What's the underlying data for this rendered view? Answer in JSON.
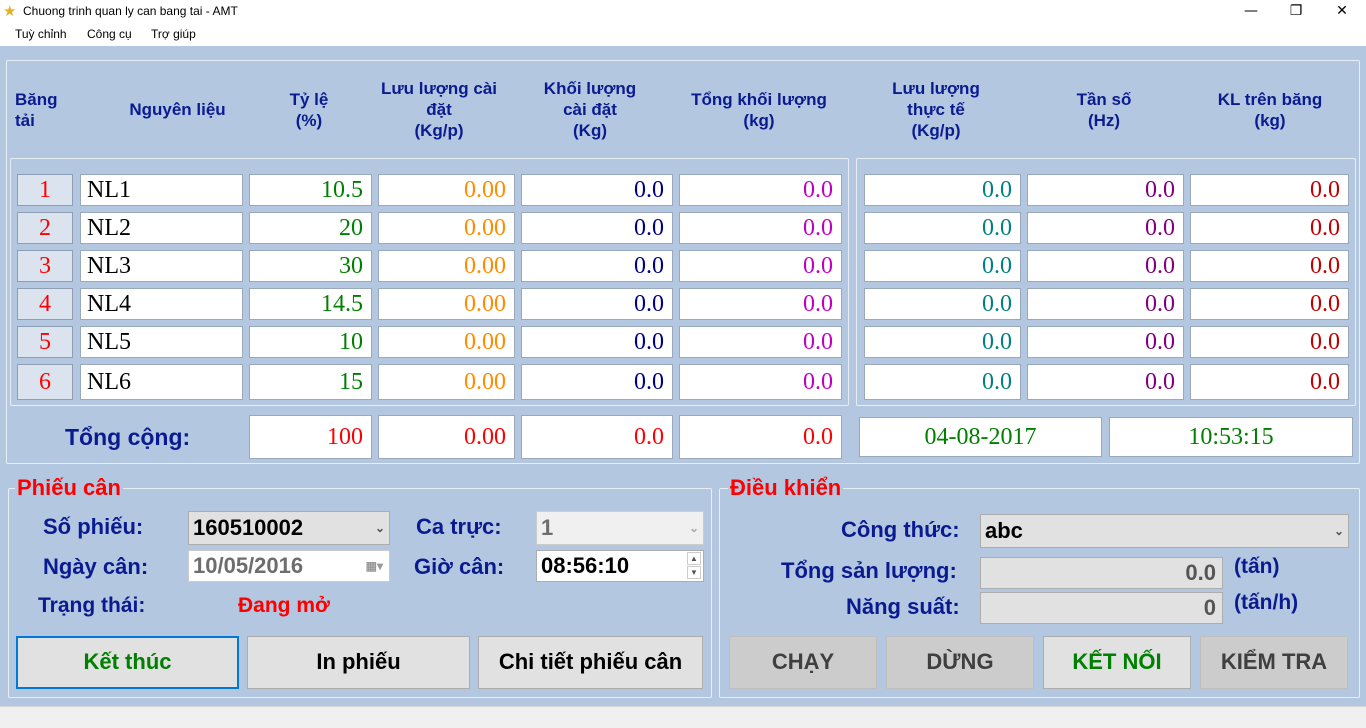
{
  "window": {
    "title": "Chuong trinh quan ly can bang tai - AMT",
    "minimize": "—",
    "restore": "❐",
    "close": "✕"
  },
  "menu": [
    "Tuỳ chỉnh",
    "Công cụ",
    "Trợ giúp"
  ],
  "headers": {
    "bang_tai": "Băng\ntải",
    "nguyen_lieu": "Nguyên liệu",
    "ty_le": "Tỷ lệ\n(%)",
    "luu_luong_cai_dat": "Lưu lượng cài\nđặt\n(Kg/p)",
    "khoi_luong_cai_dat": "Khối lượng\ncài đặt\n(Kg)",
    "tong_khoi_luong": "Tổng khối lượng\n(kg)",
    "luu_luong_thuc_te": "Lưu lượng\nthực tế\n(Kg/p)",
    "tan_so": "Tần số\n(Hz)",
    "kl_tren_bang": "KL trên băng\n(kg)"
  },
  "rows": [
    {
      "idx": "1",
      "name": "NL1",
      "ratio": "10.5",
      "flow_set": "0.00",
      "mass_set": "0.0",
      "total_mass": "0.0",
      "flow_actual": "0.0",
      "freq": "0.0",
      "kl": "0.0"
    },
    {
      "idx": "2",
      "name": "NL2",
      "ratio": "20",
      "flow_set": "0.00",
      "mass_set": "0.0",
      "total_mass": "0.0",
      "flow_actual": "0.0",
      "freq": "0.0",
      "kl": "0.0"
    },
    {
      "idx": "3",
      "name": "NL3",
      "ratio": "30",
      "flow_set": "0.00",
      "mass_set": "0.0",
      "total_mass": "0.0",
      "flow_actual": "0.0",
      "freq": "0.0",
      "kl": "0.0"
    },
    {
      "idx": "4",
      "name": "NL4",
      "ratio": "14.5",
      "flow_set": "0.00",
      "mass_set": "0.0",
      "total_mass": "0.0",
      "flow_actual": "0.0",
      "freq": "0.0",
      "kl": "0.0"
    },
    {
      "idx": "5",
      "name": "NL5",
      "ratio": "10",
      "flow_set": "0.00",
      "mass_set": "0.0",
      "total_mass": "0.0",
      "flow_actual": "0.0",
      "freq": "0.0",
      "kl": "0.0"
    },
    {
      "idx": "6",
      "name": "NL6",
      "ratio": "15",
      "flow_set": "0.00",
      "mass_set": "0.0",
      "total_mass": "0.0",
      "flow_actual": "0.0",
      "freq": "0.0",
      "kl": "0.0"
    }
  ],
  "total": {
    "label": "Tổng cộng:",
    "ratio": "100",
    "flow_set": "0.00",
    "mass_set": "0.0",
    "total_mass": "0.0",
    "date": "04-08-2017",
    "time": "10:53:15"
  },
  "ticket": {
    "title": "Phiếu cân",
    "so_phieu_label": "Số phiếu:",
    "so_phieu": "160510002",
    "ca_truc_label": "Ca trực:",
    "ca_truc": "1",
    "ngay_can_label": "Ngày cân:",
    "ngay_can": "10/05/2016",
    "gio_can_label": "Giờ cân:",
    "gio_can": "08:56:10",
    "trang_thai_label": "Trạng thái:",
    "trang_thai": "Đang mở",
    "btn_ket_thuc": "Kết thúc",
    "btn_in_phieu": "In phiếu",
    "btn_chi_tiet": "Chi tiết phiếu cân"
  },
  "control": {
    "title": "Điều khiển",
    "cong_thuc_label": "Công thức:",
    "cong_thuc": "abc",
    "tong_san_luong_label": "Tổng sản lượng:",
    "tong_san_luong": "0.0",
    "tong_san_luong_unit": "(tấn)",
    "nang_suat_label": "Năng suất:",
    "nang_suat": "0",
    "nang_suat_unit": "(tấn/h)",
    "btn_chay": "CHẠY",
    "btn_dung": "DỪNG",
    "btn_ket_noi": "KẾT NỐI",
    "btn_kiem_tra": "KIỂM TRA"
  },
  "colors": {
    "background": "#b3c7e1",
    "header_text": "#0b1b8f",
    "index_text": "#ff0000",
    "ratio_text": "#008000",
    "flow_set_text": "#ff8c00",
    "mass_set_text": "#000080",
    "total_mass_text": "#c000c0",
    "flow_actual_text": "#008080",
    "freq_text": "#800080",
    "kl_text": "#c00000"
  }
}
